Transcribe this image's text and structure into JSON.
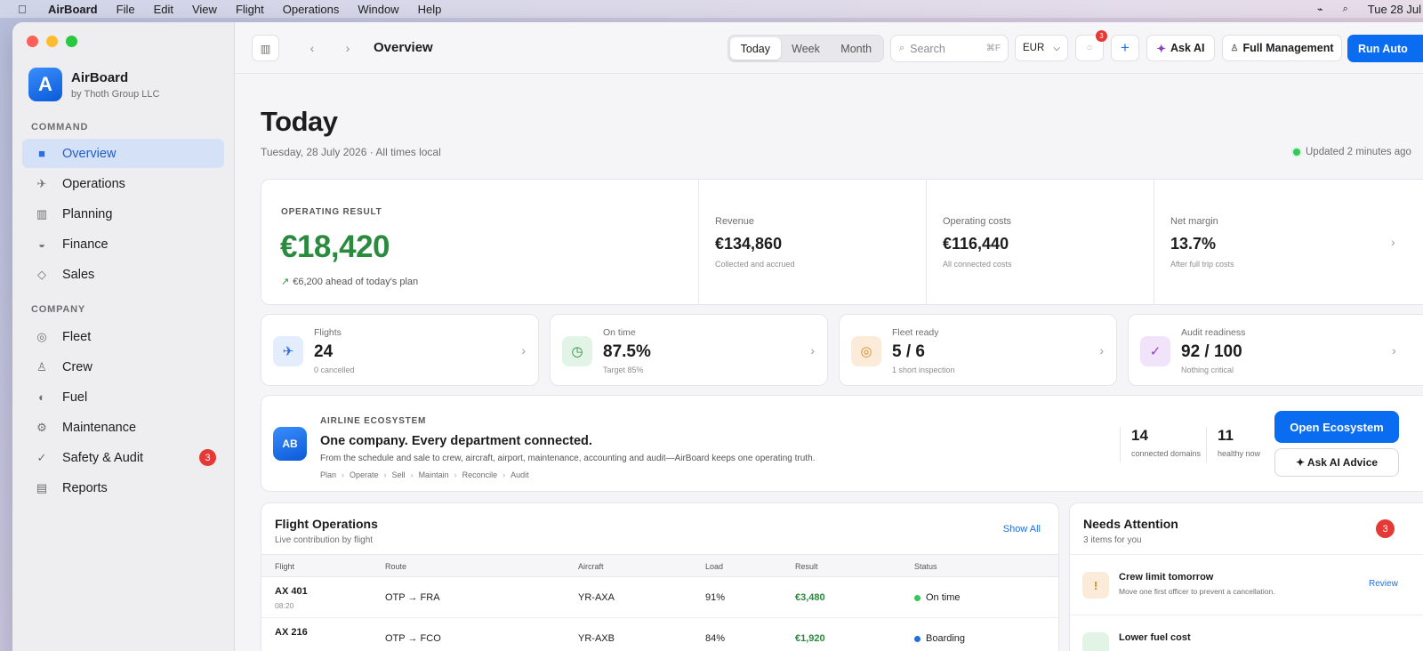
{
  "menubar": {
    "app": "AirBoard",
    "items": [
      "File",
      "Edit",
      "View",
      "Flight",
      "Operations",
      "Window",
      "Help"
    ],
    "clock": "Tue 28 Jul"
  },
  "sidebar": {
    "app_name": "AirBoard",
    "app_org": "by Thoth Group LLC",
    "logo_letter": "A",
    "command_label": "COMMAND",
    "company_label": "COMPANY",
    "command_items": [
      {
        "label": "Overview",
        "icon": "square-icon",
        "active": true
      },
      {
        "label": "Operations",
        "icon": "plane-icon"
      },
      {
        "label": "Planning",
        "icon": "grid-icon"
      },
      {
        "label": "Finance",
        "icon": "half-circle-icon"
      },
      {
        "label": "Sales",
        "icon": "diamond-icon"
      }
    ],
    "company_items": [
      {
        "label": "Fleet",
        "icon": "ring-icon"
      },
      {
        "label": "Crew",
        "icon": "person-icon"
      },
      {
        "label": "Fuel",
        "icon": "drop-icon"
      },
      {
        "label": "Maintenance",
        "icon": "gear-icon"
      },
      {
        "label": "Safety & Audit",
        "icon": "check-icon",
        "badge": "3"
      },
      {
        "label": "Reports",
        "icon": "document-icon"
      }
    ]
  },
  "toolbar": {
    "title": "Overview",
    "segments": [
      "Today",
      "Week",
      "Month"
    ],
    "search_placeholder": "Search",
    "search_shortcut": "⌘F",
    "currency": "EUR",
    "notif_count": "3",
    "ask_ai": "Ask AI",
    "full_management": "Full Management",
    "run": "Run Auto"
  },
  "header": {
    "title": "Today",
    "date": "Tuesday, 28 July 2026 · All times local",
    "updated": "Updated 2 minutes ago"
  },
  "result": {
    "label": "OPERATING RESULT",
    "value": "€18,420",
    "sub": "€6,200 ahead of today's plan",
    "metrics": [
      {
        "label": "Revenue",
        "value": "€134,860",
        "sub": "Collected and accrued"
      },
      {
        "label": "Operating costs",
        "value": "€116,440",
        "sub": "All connected costs"
      },
      {
        "label": "Net margin",
        "value": "13.7%",
        "sub": "After full trip costs"
      }
    ]
  },
  "kpis": [
    {
      "label": "Flights",
      "value": "24",
      "sub": "0 cancelled",
      "icon": "plane-icon",
      "color": "#2f6fdc",
      "bg": "#e3edfc"
    },
    {
      "label": "On time",
      "value": "87.5%",
      "sub": "Target 85%",
      "icon": "clock-icon",
      "color": "#2a8a3e",
      "bg": "#e2f4e6"
    },
    {
      "label": "Fleet ready",
      "value": "5 / 6",
      "sub": "1 short inspection",
      "icon": "ring-icon",
      "color": "#d98a2b",
      "bg": "#fcebd8"
    },
    {
      "label": "Audit readiness",
      "value": "92 / 100",
      "sub": "Nothing critical",
      "icon": "check-icon",
      "color": "#8e3fc4",
      "bg": "#f1e3f9"
    }
  ],
  "ecosystem": {
    "logo": "AB",
    "label": "AIRLINE ECOSYSTEM",
    "title": "One company. Every department connected.",
    "desc": "From the schedule and sale to crew, aircraft, airport, maintenance, accounting and audit—AirBoard keeps one operating truth.",
    "steps": [
      "Plan",
      "Operate",
      "Sell",
      "Maintain",
      "Reconcile",
      "Audit"
    ],
    "stats": [
      {
        "n": "14",
        "t": "connected domains"
      },
      {
        "n": "11",
        "t": "healthy now"
      }
    ],
    "open": "Open Ecosystem",
    "ask": "✦ Ask AI Advice"
  },
  "flights": {
    "title": "Flight Operations",
    "sub": "Live contribution by flight",
    "show_all": "Show All",
    "columns": [
      "Flight",
      "Route",
      "Aircraft",
      "Load",
      "Result",
      "Status"
    ],
    "rows": [
      {
        "flight": "AX 401",
        "time": "08:20",
        "route": "OTP → FRA",
        "aircraft": "YR-AXA",
        "load": "91%",
        "result": "€3,480",
        "status": "On time",
        "status_color": "#34c759"
      },
      {
        "flight": "AX 216",
        "time": "",
        "route": "OTP → FCO",
        "aircraft": "YR-AXB",
        "load": "84%",
        "result": "€1,920",
        "status": "Boarding",
        "status_color": "#1f6fe0"
      }
    ]
  },
  "attention": {
    "title": "Needs Attention",
    "sub": "3 items for you",
    "count": "3",
    "items": [
      {
        "title": "Crew limit tomorrow",
        "desc": "Move one first officer to prevent a cancellation.",
        "action": "Review",
        "icon": "!",
        "color": "#d98a2b",
        "bg": "#fcebd8"
      },
      {
        "title": "Lower fuel cost",
        "desc": "",
        "action": "",
        "icon": "",
        "color": "#2a8a3e",
        "bg": "#e2f4e6"
      }
    ]
  }
}
